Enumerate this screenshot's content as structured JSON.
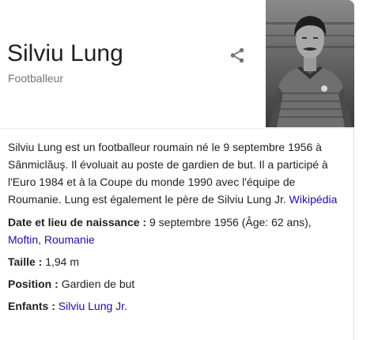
{
  "header": {
    "title": "Silviu Lung",
    "subtitle": "Footballeur"
  },
  "icons": {
    "share": "share-icon"
  },
  "description": {
    "text": "Silviu Lung est un footballeur roumain né le 9 septembre 1956 à Sânmiclăuş. Il évoluait au poste de gardien de but. Il a participé à l'Euro 1984 et à la Coupe du monde 1990 avec l'équipe de Roumanie. Lung est également le père de Silviu Lung Jr. ",
    "source_link": "Wikipédia"
  },
  "facts": {
    "birth": {
      "label": "Date et lieu de naissance",
      "value": "9 septembre 1956 (Âge: 62 ans), ",
      "place_link": "Moftin",
      "separator": ", ",
      "country_link": "Roumanie"
    },
    "height": {
      "label": "Taille",
      "value": "1,94 m"
    },
    "position": {
      "label": "Position",
      "value": "Gardien de but"
    },
    "children": {
      "label": "Enfants",
      "link": "Silviu Lung Jr."
    }
  },
  "colors": {
    "link": "#1a0dab",
    "subtitle": "#70757a",
    "title": "#202124"
  }
}
